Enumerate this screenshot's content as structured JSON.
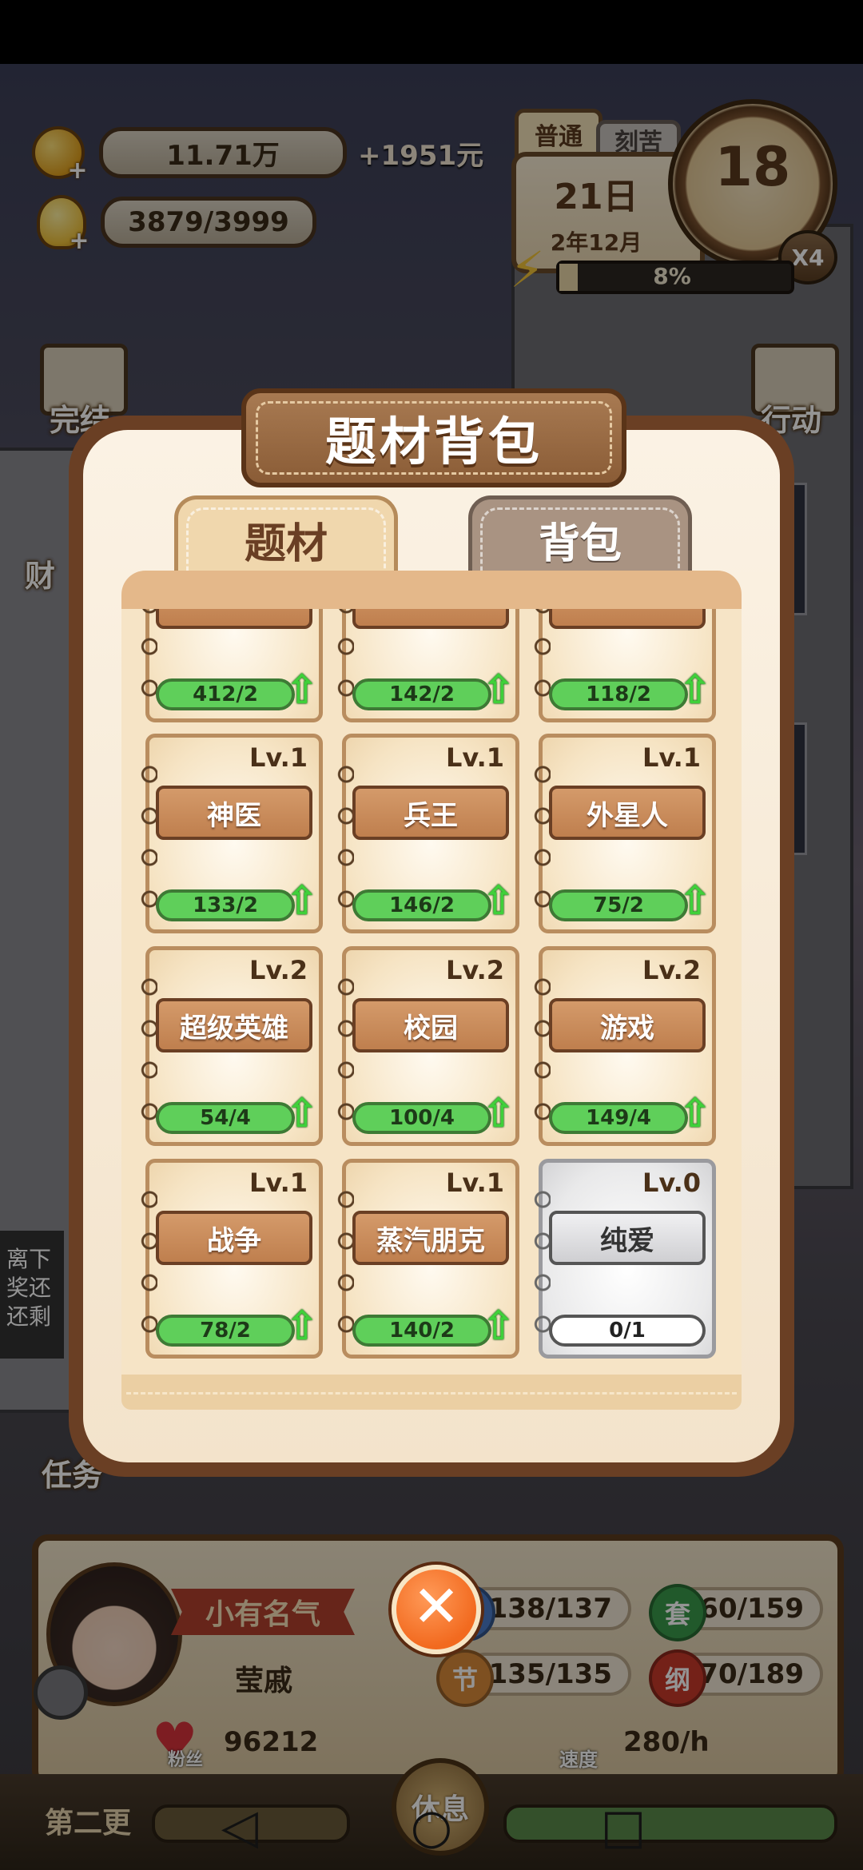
{
  "hud": {
    "money": "11.71万",
    "money_gain": "+1951元",
    "inspiration": "3879/3999",
    "mode_tabs": [
      "普通",
      "刻苦"
    ],
    "day": "21日",
    "year_month": "2年12月",
    "clock_hour": "18",
    "speed_multiplier": "X4",
    "energy_percent_text": "8%",
    "energy_fraction": 0.08
  },
  "side_buttons": {
    "left_top": "完结",
    "left_mid": "财",
    "left_task": "任务",
    "right_top": "行动"
  },
  "notification": [
    "离下",
    "奖还",
    "还剩"
  ],
  "modal": {
    "title": "题材背包",
    "tabs": [
      {
        "label": "题材",
        "active": true
      },
      {
        "label": "背包",
        "active": false
      }
    ]
  },
  "topics": [
    {
      "level": "",
      "name": "",
      "progress": "412/2",
      "locked": false
    },
    {
      "level": "",
      "name": "",
      "progress": "142/2",
      "locked": false
    },
    {
      "level": "",
      "name": "",
      "progress": "118/2",
      "locked": false
    },
    {
      "level": "Lv.1",
      "name": "神医",
      "progress": "133/2",
      "locked": false
    },
    {
      "level": "Lv.1",
      "name": "兵王",
      "progress": "146/2",
      "locked": false
    },
    {
      "level": "Lv.1",
      "name": "外星人",
      "progress": "75/2",
      "locked": false
    },
    {
      "level": "Lv.2",
      "name": "超级英雄",
      "progress": "54/4",
      "locked": false
    },
    {
      "level": "Lv.2",
      "name": "校园",
      "progress": "100/4",
      "locked": false
    },
    {
      "level": "Lv.2",
      "name": "游戏",
      "progress": "149/4",
      "locked": false
    },
    {
      "level": "Lv.1",
      "name": "战争",
      "progress": "78/2",
      "locked": false
    },
    {
      "level": "Lv.1",
      "name": "蒸汽朋克",
      "progress": "140/2",
      "locked": false
    },
    {
      "level": "Lv.0",
      "name": "纯爱",
      "progress": "0/1",
      "locked": true
    }
  ],
  "profile": {
    "title": "小有名气",
    "name": "莹戚",
    "fans_label": "粉丝",
    "fans": "96212"
  },
  "stats": {
    "s1": "138/137",
    "s2_badge": "套",
    "s2": "160/159",
    "s3_badge": "节",
    "s3": "135/135",
    "s4_badge": "纲",
    "s4": "170/189",
    "speed_label": "速度",
    "speed": "280/h"
  },
  "chapter": {
    "label": "第二更",
    "update_button": "休息"
  },
  "colors": {
    "modal_border": "#6a3f24",
    "progress_green": "#5fcf5a",
    "close_orange": "#f26a1f"
  }
}
